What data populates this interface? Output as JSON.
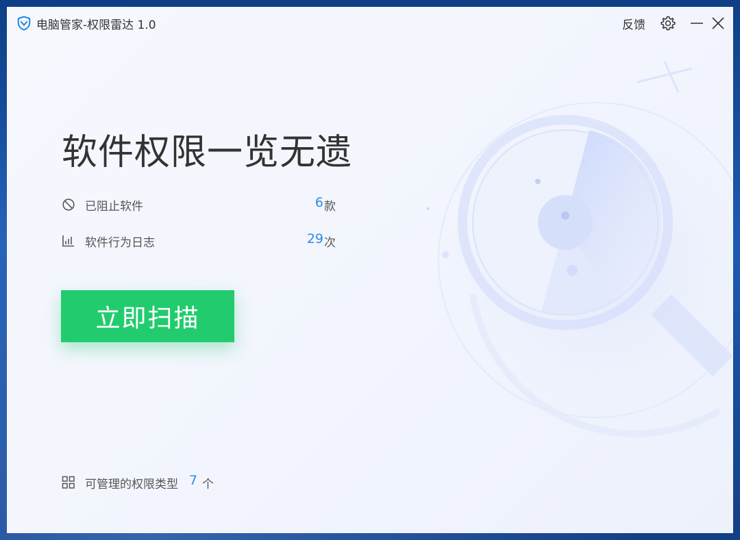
{
  "window": {
    "title": "电脑管家-权限雷达 1.0",
    "feedback_label": "反馈"
  },
  "hero": {
    "headline": "软件权限一览无遗"
  },
  "stats": [
    {
      "label": "已阻止软件",
      "value": "6",
      "unit": "款",
      "icon": "block-icon"
    },
    {
      "label": "软件行为日志",
      "value": "29",
      "unit": "次",
      "icon": "chart-icon"
    }
  ],
  "actions": {
    "scan_label": "立即扫描"
  },
  "footer": {
    "label": "可管理的权限类型",
    "count": "7",
    "unit": "个",
    "icon": "grid-icon"
  },
  "colors": {
    "accent_blue": "#2b8ce6",
    "scan_green": "#22cc6e",
    "logo_blue": "#1e88e5"
  }
}
